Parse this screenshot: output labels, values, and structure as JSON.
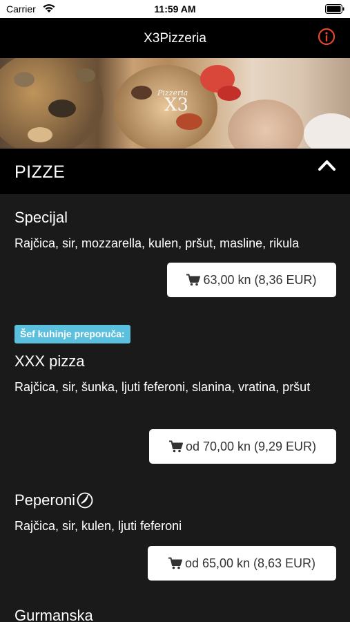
{
  "status_bar": {
    "carrier": "Carrier",
    "time": "11:59 AM"
  },
  "nav": {
    "title": "X3Pizzeria"
  },
  "hero": {
    "logo_small": "Pizzeria",
    "logo_big": "X3"
  },
  "section": {
    "title": "PIZZE"
  },
  "items": [
    {
      "name": "Specijal",
      "desc": "Rajčica, sir, mozzarella, kulen, pršut, masline, rikula",
      "price": "63,00 kn (8,36 EUR)"
    },
    {
      "badge": "Šef kuhinje preporuča:",
      "name": "XXX pizza",
      "desc": "Rajčica, sir, šunka, ljuti feferoni, slanina, vratina, pršut",
      "price": "od 70,00 kn (9,29 EUR)"
    },
    {
      "name": "Peperoni",
      "desc": "Rajčica, sir, kulen, ljuti feferoni",
      "price": "od 65,00 kn (8,63 EUR)",
      "icon": "chili-pepper-icon"
    },
    {
      "name": "Gurmanska"
    }
  ],
  "colors": {
    "accent": "#e8472b",
    "badge": "#5bc0de",
    "background": "#1a1a1a"
  }
}
